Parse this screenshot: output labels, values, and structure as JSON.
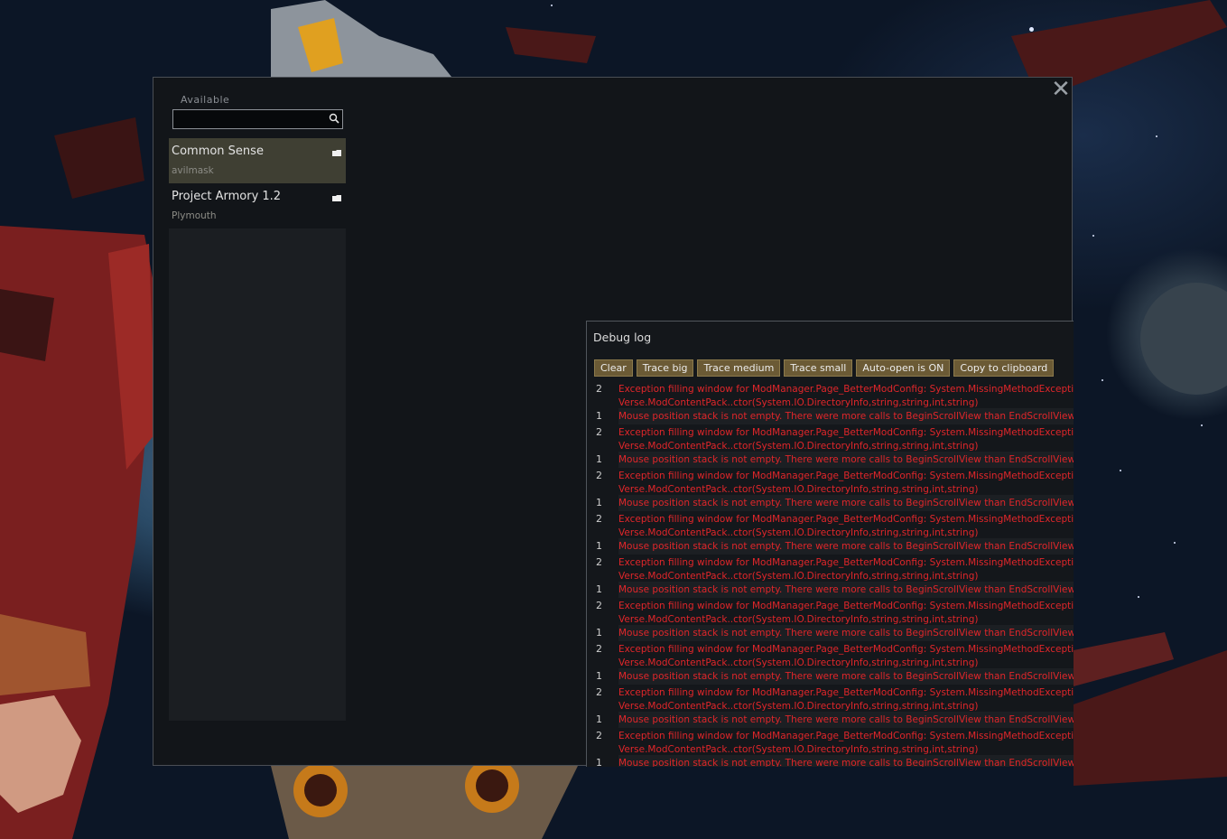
{
  "window": {
    "close_glyph": "✕",
    "available_label": "Available",
    "search": {
      "value": "",
      "placeholder": ""
    }
  },
  "mods": [
    {
      "name": "Common Sense",
      "author": "avilmask",
      "selected": true,
      "icon": "folder-icon"
    },
    {
      "name": "Project Armory 1.2",
      "author": "Plymouth",
      "selected": false,
      "icon": "folder-icon"
    }
  ],
  "debug_log": {
    "title": "Debug log",
    "buttons": [
      "Clear",
      "Trace big",
      "Trace medium",
      "Trace small",
      "Auto-open is ON",
      "Copy to clipboard"
    ],
    "entries": [
      {
        "count": "2",
        "text": "Exception filling window for ModManager.Page_BetterModConfig: System.MissingMethodException",
        "text2": "Verse.ModContentPack..ctor(System.IO.DirectoryInfo,string,string,int,string)"
      },
      {
        "count": "1",
        "text": "Mouse position stack is not empty. There were more calls to BeginScrollView than EndScrollView"
      },
      {
        "count": "2",
        "text": "Exception filling window for ModManager.Page_BetterModConfig: System.MissingMethodException",
        "text2": "Verse.ModContentPack..ctor(System.IO.DirectoryInfo,string,string,int,string)"
      },
      {
        "count": "1",
        "text": "Mouse position stack is not empty. There were more calls to BeginScrollView than EndScrollView"
      },
      {
        "count": "2",
        "text": "Exception filling window for ModManager.Page_BetterModConfig: System.MissingMethodException",
        "text2": "Verse.ModContentPack..ctor(System.IO.DirectoryInfo,string,string,int,string)"
      },
      {
        "count": "1",
        "text": "Mouse position stack is not empty. There were more calls to BeginScrollView than EndScrollView"
      },
      {
        "count": "2",
        "text": "Exception filling window for ModManager.Page_BetterModConfig: System.MissingMethodException",
        "text2": "Verse.ModContentPack..ctor(System.IO.DirectoryInfo,string,string,int,string)"
      },
      {
        "count": "1",
        "text": "Mouse position stack is not empty. There were more calls to BeginScrollView than EndScrollView"
      },
      {
        "count": "2",
        "text": "Exception filling window for ModManager.Page_BetterModConfig: System.MissingMethodException",
        "text2": "Verse.ModContentPack..ctor(System.IO.DirectoryInfo,string,string,int,string)"
      },
      {
        "count": "1",
        "text": "Mouse position stack is not empty. There were more calls to BeginScrollView than EndScrollView"
      },
      {
        "count": "2",
        "text": "Exception filling window for ModManager.Page_BetterModConfig: System.MissingMethodException",
        "text2": "Verse.ModContentPack..ctor(System.IO.DirectoryInfo,string,string,int,string)"
      },
      {
        "count": "1",
        "text": "Mouse position stack is not empty. There were more calls to BeginScrollView than EndScrollView"
      },
      {
        "count": "2",
        "text": "Exception filling window for ModManager.Page_BetterModConfig: System.MissingMethodException",
        "text2": "Verse.ModContentPack..ctor(System.IO.DirectoryInfo,string,string,int,string)"
      },
      {
        "count": "1",
        "text": "Mouse position stack is not empty. There were more calls to BeginScrollView than EndScrollView"
      },
      {
        "count": "2",
        "text": "Exception filling window for ModManager.Page_BetterModConfig: System.MissingMethodException",
        "text2": "Verse.ModContentPack..ctor(System.IO.DirectoryInfo,string,string,int,string)"
      },
      {
        "count": "1",
        "text": "Mouse position stack is not empty. There were more calls to BeginScrollView than EndScrollView"
      },
      {
        "count": "2",
        "text": "Exception filling window for ModManager.Page_BetterModConfig: System.MissingMethodException",
        "text2": "Verse.ModContentPack..ctor(System.IO.DirectoryInfo,string,string,int,string)"
      },
      {
        "count": "1",
        "text": "Mouse position stack is not empty. There were more calls to BeginScrollView than EndScrollView"
      }
    ]
  },
  "colors": {
    "selected_mod_bg": "#3f3f33",
    "button_bg": "#6b5a35",
    "error_text": "#e0262a"
  }
}
